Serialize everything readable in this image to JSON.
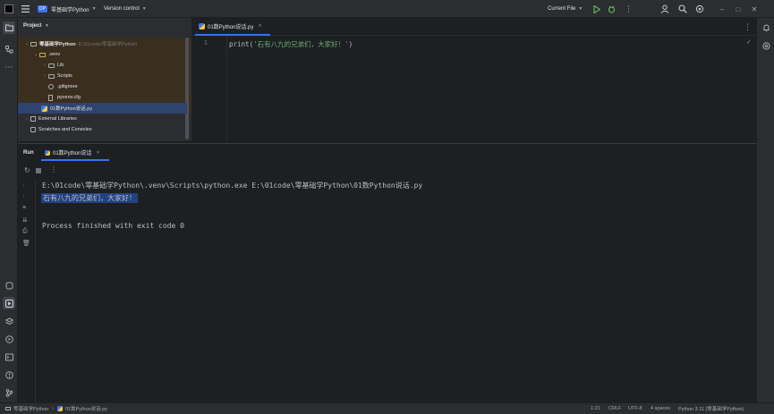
{
  "titlebar": {
    "project_badge": "DP",
    "project_name": "零基础学Python",
    "vcs": "Version control",
    "run_config": "Current File"
  },
  "project_panel": {
    "title": "Project",
    "tree": [
      {
        "label": "零基础学Python",
        "path": "E:\\01code\\零基础学Python"
      },
      {
        "label": ".venv"
      },
      {
        "label": "Lib"
      },
      {
        "label": "Scripts"
      },
      {
        "label": ".gitignore"
      },
      {
        "label": "pyvenv.cfg"
      },
      {
        "label": "01数Python说话.py"
      },
      {
        "label": "External Libraries"
      },
      {
        "label": "Scratches and Consoles"
      }
    ]
  },
  "editor": {
    "tab_label": "01数Python说话.py",
    "lines": [
      {
        "number": "1",
        "code": "print('石有八九的兄弟们，大家好！')"
      }
    ]
  },
  "run_panel": {
    "title": "Run",
    "tab_label": "01数Python说话",
    "output": [
      "E:\\01code\\零基础学Python\\.venv\\Scripts\\python.exe E:\\01code\\零基础学Python\\01数Python说话.py",
      "石有八九的兄弟们，大家好！",
      "",
      "Process finished with exit code 0"
    ]
  },
  "status": {
    "breadcrumb_root": "零基础学Python",
    "breadcrumb_file": "01数Python说话.py",
    "position": "1:21",
    "line_sep": "CRLF",
    "encoding": "UTF-8",
    "indent": "4 spaces",
    "interpreter": "Python 3.11 (零基础学Python)"
  },
  "colors": {
    "accent": "#3574f0",
    "selection": "#214283",
    "string": "#6aab73"
  }
}
